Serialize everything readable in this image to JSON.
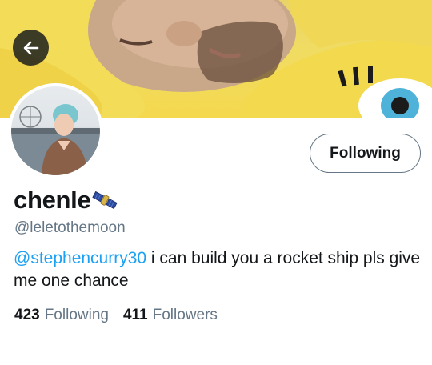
{
  "header": {
    "back_icon": "arrow-left-icon",
    "banner_description_icon": "banner-photo"
  },
  "profile": {
    "display_name": "chenle",
    "name_emoji": "satellite-emoji",
    "handle": "@leletothemoon",
    "follow_button_label": "Following",
    "bio": {
      "mention": "@stephencurry30",
      "text": " i can build you a rocket ship pls give me one chance"
    },
    "stats": {
      "following_count": "423",
      "following_label": "Following",
      "followers_count": "411",
      "followers_label": "Followers"
    }
  },
  "colors": {
    "accent": "#1da1f2",
    "secondary_text": "#657786",
    "primary_text": "#14171a"
  }
}
